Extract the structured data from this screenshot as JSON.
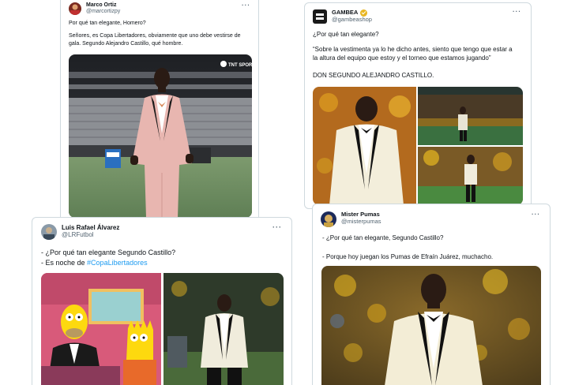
{
  "tweets": [
    {
      "display_name": "Marco Ortiz",
      "handle": "@marcortizpy",
      "text": [
        "Por qué tan elegante, Homero?",
        "Señores, es Copa Libertadores, obviamente que uno debe vestirse de",
        "gala. Segundo Alejandro Castillo, qué hombre."
      ],
      "watermark": "TNT SPORTS"
    },
    {
      "display_name": "GAMBEA",
      "handle": "@gambeashop",
      "text": [
        "¿Por qué tan elegante?",
        "“Sobre la vestimenta ya lo he dicho antes, siento que tengo que estar a",
        "la altura del equipo que estoy y el torneo que estamos jugando”",
        "DON SEGUNDO ALEJANDRO CASTILLO."
      ]
    },
    {
      "display_name": "Luis Rafael Álvarez",
      "handle": "@LRFutbol",
      "text": [
        "- ¿Por qué tan elegante Segundo Castillo?",
        "- Es noche de "
      ],
      "hashtag": "#CopaLibertadores"
    },
    {
      "display_name": "Mister Pumas",
      "handle": "@misterpumas",
      "text": [
        "- ¿Por qué tan elegante, Segundo Castillo?",
        "- Porque hoy juegan los Pumas de Efraín Juárez, muchacho."
      ]
    }
  ],
  "more_label": "···",
  "colors": {
    "hashtag": "#1d9bf0",
    "secondary_text": "#536471",
    "border": "#cfd9de",
    "verified": "#e8b623"
  }
}
